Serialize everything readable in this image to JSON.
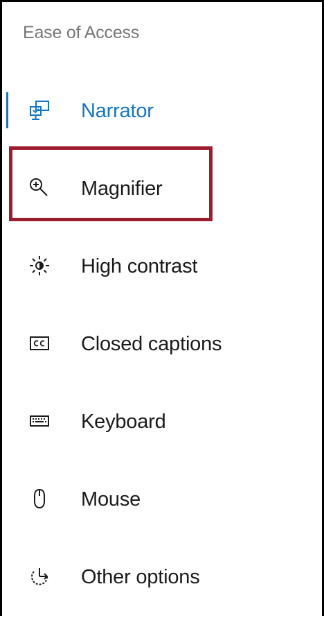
{
  "section": {
    "title": "Ease of Access"
  },
  "nav": {
    "items": [
      {
        "id": "narrator",
        "label": "Narrator",
        "icon": "narrator-icon",
        "selected": true
      },
      {
        "id": "magnifier",
        "label": "Magnifier",
        "icon": "magnifier-icon",
        "selected": false,
        "highlighted": true
      },
      {
        "id": "high-contrast",
        "label": "High contrast",
        "icon": "high-contrast-icon",
        "selected": false
      },
      {
        "id": "closed-captions",
        "label": "Closed captions",
        "icon": "closed-captions-icon",
        "selected": false
      },
      {
        "id": "keyboard",
        "label": "Keyboard",
        "icon": "keyboard-icon",
        "selected": false
      },
      {
        "id": "mouse",
        "label": "Mouse",
        "icon": "mouse-icon",
        "selected": false
      },
      {
        "id": "other-options",
        "label": "Other options",
        "icon": "other-options-icon",
        "selected": false
      }
    ]
  },
  "colors": {
    "accent": "#1375c6",
    "highlight_border": "#9c1e2e",
    "text": "#1a1a1a",
    "section_title": "#767676"
  }
}
